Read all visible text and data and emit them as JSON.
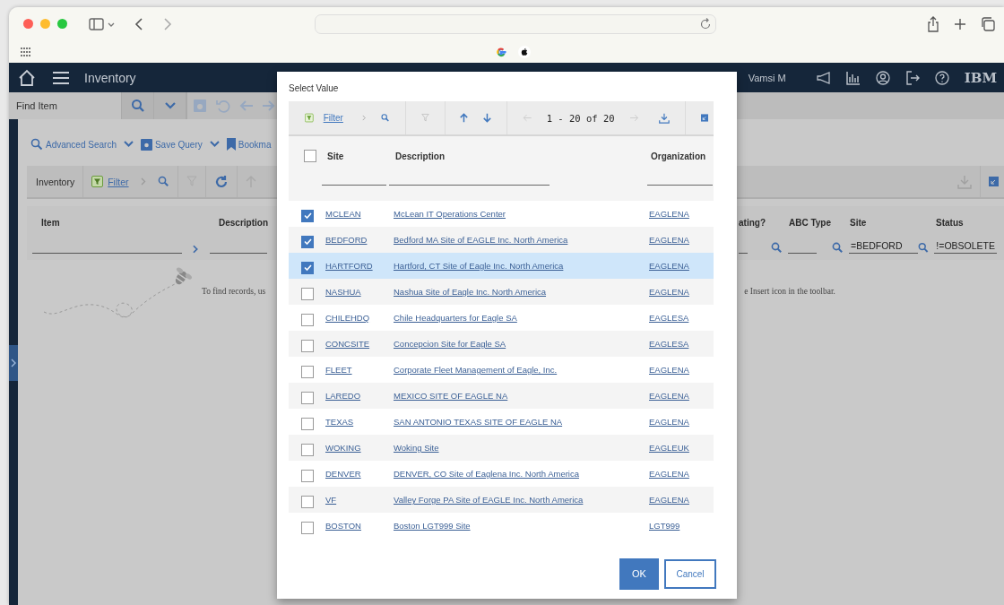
{
  "header": {
    "title": "Inventory",
    "user": "Vamsi M",
    "logo": "IBM"
  },
  "find_bar": {
    "placeholder": "Find Item"
  },
  "actions": [
    {
      "label": "Advanced Search",
      "kind": "search",
      "menu": true
    },
    {
      "label": "Save Query",
      "kind": "save",
      "menu": true
    },
    {
      "label": "Bookma",
      "kind": "bookmark",
      "menu": false
    }
  ],
  "table": {
    "title": "Inventory",
    "filter_link": "Filter",
    "left_columns": [
      {
        "label": "Item"
      },
      {
        "label": "Description"
      }
    ],
    "right_columns": [
      {
        "label": "ating?"
      },
      {
        "label": "ABC Type"
      },
      {
        "label": "Site",
        "filter": "=BEDFORD"
      },
      {
        "label": "Status",
        "filter": "!=OBSOLETE"
      }
    ],
    "message": [
      "To find records, us",
      "e Insert icon in the toolbar."
    ]
  },
  "dialog": {
    "title": "Select Value",
    "filter_link": "Filter",
    "pagination": "1 - 20 of 20",
    "columns": [
      "Site",
      "Description",
      "Organization"
    ],
    "select_all_checked": false,
    "rows": [
      {
        "site": "MCLEAN",
        "description": "McLean IT Operations Center",
        "org": "EAGLENA",
        "checked": true,
        "current": false
      },
      {
        "site": "BEDFORD",
        "description": "Bedford MA Site of EAGLE Inc. North America",
        "org": "EAGLENA",
        "checked": true,
        "current": false
      },
      {
        "site": "HARTFORD",
        "description": "Hartford, CT Site of Eagle Inc. North America",
        "org": "EAGLENA",
        "checked": true,
        "current": true
      },
      {
        "site": "NASHUA",
        "description": "Nashua Site of Eagle Inc. North America",
        "org": "EAGLENA",
        "checked": false,
        "current": false
      },
      {
        "site": "CHILEHDQ",
        "description": "Chile Headquarters for Eagle SA",
        "org": "EAGLESA",
        "checked": false,
        "current": false
      },
      {
        "site": "CONCSITE",
        "description": "Concepcion Site for Eagle SA",
        "org": "EAGLESA",
        "checked": false,
        "current": false
      },
      {
        "site": "FLEET",
        "description": "Corporate Fleet Management of Eagle, Inc.",
        "org": "EAGLENA",
        "checked": false,
        "current": false
      },
      {
        "site": "LAREDO",
        "description": "MEXICO SITE OF EAGLE NA",
        "org": "EAGLENA",
        "checked": false,
        "current": false
      },
      {
        "site": "TEXAS",
        "description": "SAN ANTONIO TEXAS SITE OF EAGLE NA",
        "org": "EAGLENA",
        "checked": false,
        "current": false
      },
      {
        "site": "WOKING",
        "description": "Woking Site",
        "org": "EAGLEUK",
        "checked": false,
        "current": false
      },
      {
        "site": "DENVER",
        "description": "DENVER, CO Site of Eaglena Inc. North America",
        "org": "EAGLENA",
        "checked": false,
        "current": false
      },
      {
        "site": "VF",
        "description": "Valley Forge PA Site of EAGLE Inc. North America",
        "org": "EAGLENA",
        "checked": false,
        "current": false
      },
      {
        "site": "BOSTON",
        "description": "Boston LGT999 Site",
        "org": "LGT999",
        "checked": false,
        "current": false
      }
    ],
    "buttons": [
      {
        "label": "OK",
        "kind": "primary"
      },
      {
        "label": "Cancel",
        "kind": "secondary"
      }
    ]
  }
}
